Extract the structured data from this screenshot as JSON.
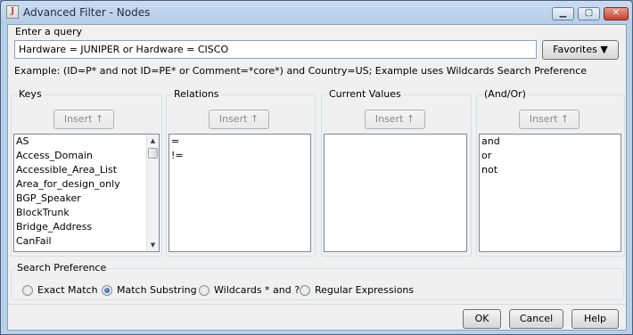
{
  "window": {
    "title": "Advanced Filter - Nodes",
    "min_icon": "minimize-icon",
    "max_icon": "maximize-icon",
    "close_icon": "close-icon"
  },
  "query": {
    "label": "Enter a query",
    "value": "Hardware = JUNIPER or Hardware = CISCO",
    "favorites_label": "Favorites ▼",
    "example": "Example: (ID=P* and not ID=PE* or Comment=*core*) and Country=US; Example uses Wildcards Search Preference"
  },
  "keys": {
    "title": "Keys",
    "insert_label": "Insert ↑",
    "items": [
      "AS",
      "Access_Domain",
      "Accessible_Area_List",
      "Area_for_design_only",
      "BGP_Speaker",
      "BlockTrunk",
      "Bridge_Address",
      "CanFail"
    ]
  },
  "relations": {
    "title": "Relations",
    "insert_label": "Insert ↑",
    "items": [
      "=",
      "!="
    ]
  },
  "current_values": {
    "title": "Current Values",
    "insert_label": "Insert ↑"
  },
  "andor": {
    "title": "(And/Or)",
    "insert_label": "Insert ↑",
    "items": [
      "and",
      "or",
      "not"
    ]
  },
  "search_preference": {
    "title": "Search Preference",
    "options": [
      "Exact Match",
      "Match Substring",
      "Wildcards * and ?",
      "Regular Expressions"
    ],
    "selected": "Match Substring"
  },
  "buttons": {
    "ok": "OK",
    "cancel": "Cancel",
    "help": "Help"
  },
  "colors": {
    "frame": "#b9d0ea",
    "dialog_bg": "#f0f0f0",
    "close_button": "#c7402c"
  }
}
